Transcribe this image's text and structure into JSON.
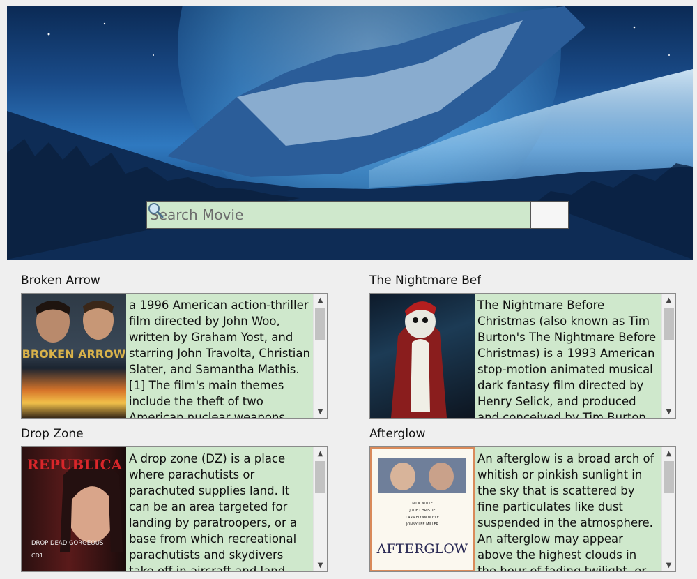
{
  "search": {
    "placeholder": "Search Movie",
    "icon": "magnifier-icon"
  },
  "movies": [
    {
      "title": "Broken Arrow",
      "description": "a 1996 American action-thriller film directed by John Woo, written by Graham Yost, and starring John Travolta, Christian Slater, and Samantha Mathis.[1] The film's main themes include the theft of two American nuclear weapons, the attempts",
      "poster_text": "BROKEN ARROW"
    },
    {
      "title": "The Nightmare Before Christmas",
      "description": "The Nightmare Before Christmas (also known as Tim Burton's The Nightmare Before Christmas) is a 1993 American stop-motion animated musical dark fantasy film directed by Henry Selick, and produced and conceived by Tim Burton. It"
    },
    {
      "title": "Drop Zone",
      "description": "A drop zone (DZ) is a place where parachutists or parachuted supplies land. It can be an area targeted for landing by paratroopers, or a base from which recreational parachutists and skydivers take off in aircraft and land under parachutes. In",
      "poster_text": "REPUBLICA",
      "poster_subtext": "DROP DEAD GORGEOUS",
      "poster_subtext2": "CD1"
    },
    {
      "title": "Afterglow",
      "description": "An afterglow is a broad arch of whitish or pinkish sunlight in the sky that is scattered by fine particulates like dust suspended in the atmosphere. An afterglow may appear above the highest clouds in the hour of fading twilight, or be",
      "poster_text": "AFTERGLOW",
      "poster_credits": [
        "NICK NOLTE",
        "JULIE CHRISTIE",
        "LARA FLYNN BOYLE",
        "JONNY LEE MILLER"
      ]
    }
  ],
  "colors": {
    "text_box_bg": "#cfe8cc",
    "page_bg": "#efefef"
  }
}
